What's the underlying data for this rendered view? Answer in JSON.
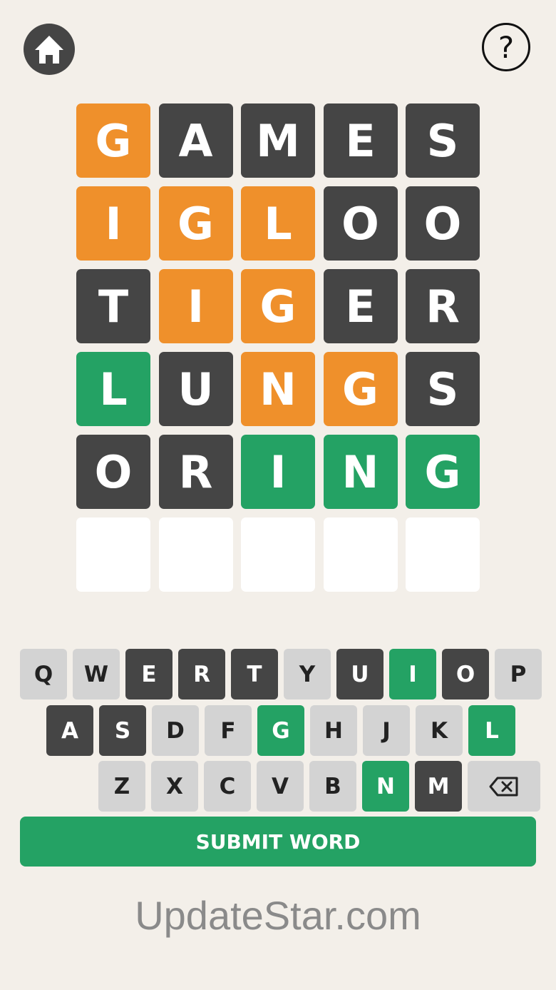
{
  "header": {
    "home_icon": "home-icon",
    "help_label": "?"
  },
  "colors": {
    "orange": "#ef902b",
    "dark": "#454545",
    "green": "#24a264",
    "empty": "#ffffff",
    "key_gray": "#d3d3d3",
    "background": "#f3efe9"
  },
  "board": {
    "rows": [
      [
        {
          "letter": "G",
          "state": "orange"
        },
        {
          "letter": "A",
          "state": "dark"
        },
        {
          "letter": "M",
          "state": "dark"
        },
        {
          "letter": "E",
          "state": "dark"
        },
        {
          "letter": "S",
          "state": "dark"
        }
      ],
      [
        {
          "letter": "I",
          "state": "orange"
        },
        {
          "letter": "G",
          "state": "orange"
        },
        {
          "letter": "L",
          "state": "orange"
        },
        {
          "letter": "O",
          "state": "dark"
        },
        {
          "letter": "O",
          "state": "dark"
        }
      ],
      [
        {
          "letter": "T",
          "state": "dark"
        },
        {
          "letter": "I",
          "state": "orange"
        },
        {
          "letter": "G",
          "state": "orange"
        },
        {
          "letter": "E",
          "state": "dark"
        },
        {
          "letter": "R",
          "state": "dark"
        }
      ],
      [
        {
          "letter": "L",
          "state": "green"
        },
        {
          "letter": "U",
          "state": "dark"
        },
        {
          "letter": "N",
          "state": "orange"
        },
        {
          "letter": "G",
          "state": "orange"
        },
        {
          "letter": "S",
          "state": "dark"
        }
      ],
      [
        {
          "letter": "O",
          "state": "dark"
        },
        {
          "letter": "R",
          "state": "dark"
        },
        {
          "letter": "I",
          "state": "green"
        },
        {
          "letter": "N",
          "state": "green"
        },
        {
          "letter": "G",
          "state": "green"
        }
      ],
      [
        {
          "letter": "",
          "state": "empty"
        },
        {
          "letter": "",
          "state": "empty"
        },
        {
          "letter": "",
          "state": "empty"
        },
        {
          "letter": "",
          "state": "empty"
        },
        {
          "letter": "",
          "state": "empty"
        }
      ]
    ]
  },
  "keyboard": {
    "rows": [
      [
        {
          "key": "Q",
          "state": "gray"
        },
        {
          "key": "W",
          "state": "gray"
        },
        {
          "key": "E",
          "state": "dark"
        },
        {
          "key": "R",
          "state": "dark"
        },
        {
          "key": "T",
          "state": "dark"
        },
        {
          "key": "Y",
          "state": "gray"
        },
        {
          "key": "U",
          "state": "dark"
        },
        {
          "key": "I",
          "state": "green"
        },
        {
          "key": "O",
          "state": "dark"
        },
        {
          "key": "P",
          "state": "gray"
        }
      ],
      [
        {
          "key": "A",
          "state": "dark"
        },
        {
          "key": "S",
          "state": "dark"
        },
        {
          "key": "D",
          "state": "gray"
        },
        {
          "key": "F",
          "state": "gray"
        },
        {
          "key": "G",
          "state": "green"
        },
        {
          "key": "H",
          "state": "gray"
        },
        {
          "key": "J",
          "state": "gray"
        },
        {
          "key": "K",
          "state": "gray"
        },
        {
          "key": "L",
          "state": "green"
        }
      ],
      [
        {
          "key": "Z",
          "state": "gray"
        },
        {
          "key": "X",
          "state": "gray"
        },
        {
          "key": "C",
          "state": "gray"
        },
        {
          "key": "V",
          "state": "gray"
        },
        {
          "key": "B",
          "state": "gray"
        },
        {
          "key": "N",
          "state": "green"
        },
        {
          "key": "M",
          "state": "dark"
        }
      ]
    ],
    "backspace_icon": "backspace-icon"
  },
  "submit_label": "SUBMIT WORD",
  "footer_text": "UpdateStar.com"
}
